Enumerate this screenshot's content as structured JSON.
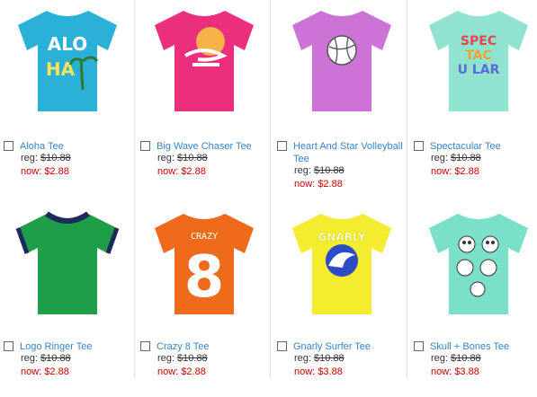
{
  "products": [
    {
      "name": "Aloha Tee",
      "reg_label": "reg:",
      "reg_price": "$10.88",
      "now_label": "now:",
      "now_price": "$2.88",
      "color": "#2bb0d8",
      "print": "ALO HA"
    },
    {
      "name": "Big Wave Chaser Tee",
      "reg_label": "reg:",
      "reg_price": "$10.88",
      "now_label": "now:",
      "now_price": "$2.88",
      "color": "#ec2f7c",
      "print": ""
    },
    {
      "name": "Heart And Star Volleyball Tee",
      "reg_label": "reg:",
      "reg_price": "$10.88",
      "now_label": "now:",
      "now_price": "$2.88",
      "color": "#cd73d7",
      "print": ""
    },
    {
      "name": "Spectacular Tee",
      "reg_label": "reg:",
      "reg_price": "$10.88",
      "now_label": "now:",
      "now_price": "$2.88",
      "color": "#8fe3cf",
      "print": "SPEC TAC U LAR"
    },
    {
      "name": "Logo Ringer Tee",
      "reg_label": "reg:",
      "reg_price": "$10.88",
      "now_label": "now:",
      "now_price": "$2.88",
      "color": "#1f9e4a",
      "print": ""
    },
    {
      "name": "Crazy 8 Tee",
      "reg_label": "reg:",
      "reg_price": "$10.88",
      "now_label": "now:",
      "now_price": "$2.88",
      "color": "#f06a1c",
      "print": "CRAZY 8"
    },
    {
      "name": "Gnarly Surfer Tee",
      "reg_label": "reg:",
      "reg_price": "$10.88",
      "now_label": "now:",
      "now_price": "$3.88",
      "color": "#f4ec2e",
      "print": "GNARLY"
    },
    {
      "name": "Skull + Bones Tee",
      "reg_label": "reg:",
      "reg_price": "$10.88",
      "now_label": "now:",
      "now_price": "$3.88",
      "color": "#7be0c8",
      "print": ""
    }
  ]
}
